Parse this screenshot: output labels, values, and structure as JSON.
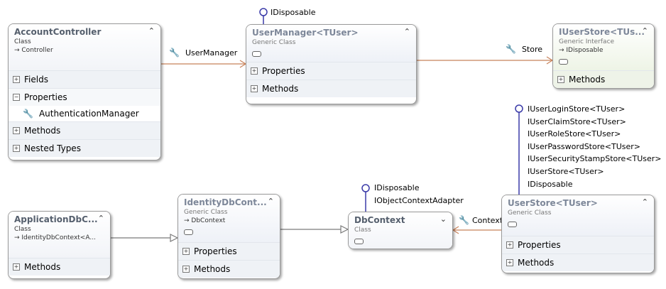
{
  "boxes": {
    "account_controller": {
      "title": "AccountController",
      "kind": "Class",
      "base": "→ Controller",
      "sections": [
        "Fields",
        "Properties",
        "Methods",
        "Nested Types"
      ],
      "members": [
        "AuthenticationManager"
      ]
    },
    "user_manager": {
      "title": "UserManager<TUser>",
      "kind": "Generic Class",
      "sections": [
        "Properties",
        "Methods"
      ]
    },
    "iuser_store": {
      "title": "IUserStore<TUs...",
      "kind": "Generic Interface",
      "base": "→ IDisposable",
      "sections": [
        "Methods"
      ]
    },
    "application_db": {
      "title": "ApplicationDbC...",
      "kind": "Class",
      "base": "→ IdentityDbContext<A...",
      "sections": [
        "Methods"
      ]
    },
    "identity_db": {
      "title": "IdentityDbCont...",
      "kind": "Generic Class",
      "base": "→ DbContext",
      "sections": [
        "Properties",
        "Methods"
      ]
    },
    "db_context": {
      "title": "DbContext",
      "kind": "Class"
    },
    "user_store": {
      "title": "UserStore<TUser>",
      "kind": "Generic Class",
      "sections": [
        "Properties",
        "Methods"
      ]
    }
  },
  "associations": {
    "user_manager": "UserManager",
    "store": "Store",
    "context": "Context"
  },
  "lollipops": {
    "user_manager": [
      "IDisposable"
    ],
    "db_context": [
      "IDisposable",
      "IObjectContextAdapter"
    ],
    "user_store": [
      "IUserLoginStore<TUser>",
      "IUserClaimStore<TUser>",
      "IUserRoleStore<TUser>",
      "IUserPasswordStore<TUser>",
      "IUserSecurityStampStore<TUser>",
      "IUserStore<TUser>",
      "IDisposable"
    ]
  },
  "colors": {
    "association_line": "#c8825a",
    "lollipop": "#3a3aa8",
    "inheritance_line": "#7a7a7a"
  },
  "icons": {
    "association": "wrench-icon",
    "collapse": "double-chevron-up-icon",
    "expand": "double-chevron-down-icon",
    "section_expand": "plus-box-icon",
    "section_collapse": "minus-box-icon"
  }
}
